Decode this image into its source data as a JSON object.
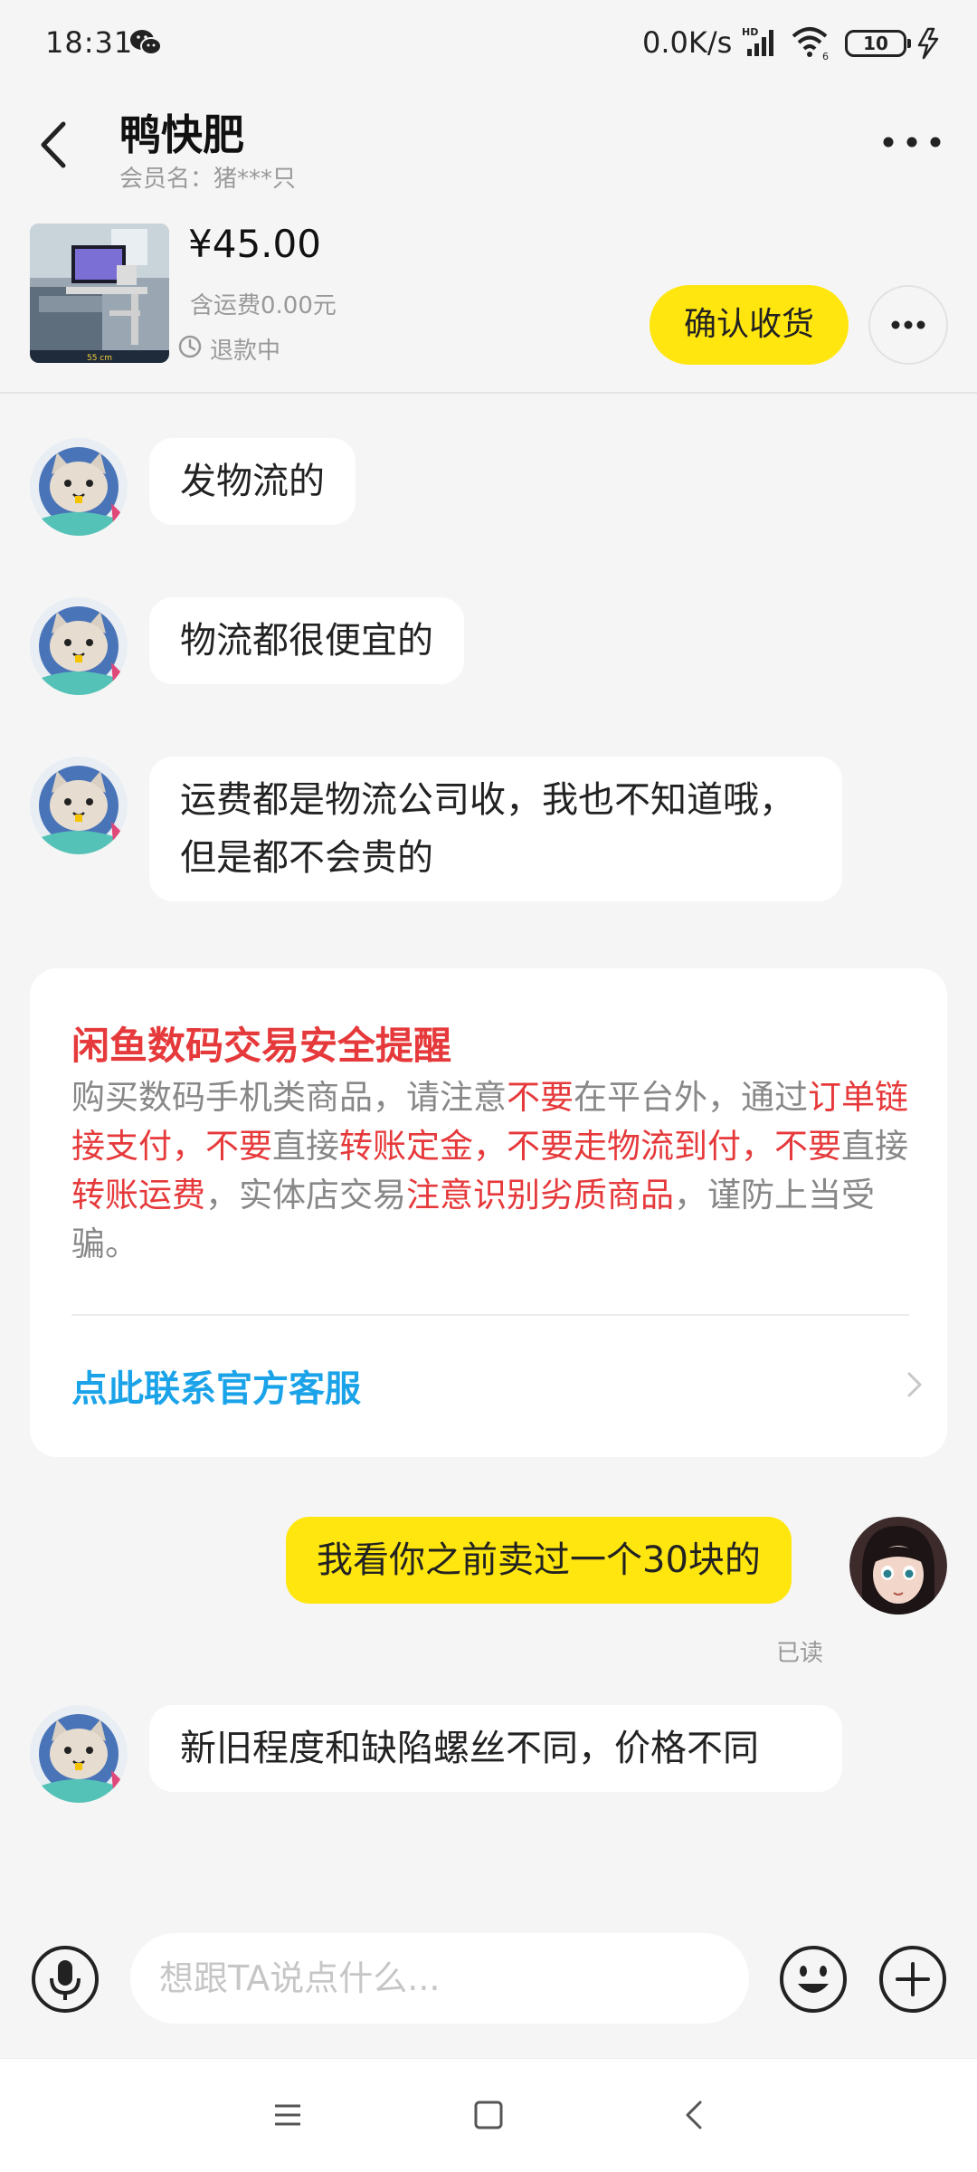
{
  "status_bar": {
    "time": "18:31",
    "network_speed": "0.0K/s",
    "battery": "10",
    "icons": [
      "wechat-icon",
      "hd-signal-icon",
      "wifi-icon",
      "battery-icon",
      "charging-icon"
    ]
  },
  "header": {
    "contact_name": "鸭快肥",
    "member_label": "会员名：猪***只",
    "product": {
      "price": "¥45.00",
      "shipping": "含运费0.00元",
      "status": "退款中",
      "confirm_button": "确认收货"
    }
  },
  "messages": [
    {
      "sender": "other",
      "text": "发物流的"
    },
    {
      "sender": "other",
      "text": "物流都很便宜的"
    },
    {
      "sender": "other",
      "text": "运费都是物流公司收，我也不知道哦，但是都不会贵的"
    },
    {
      "sender": "self",
      "text": "我看你之前卖过一个30块的",
      "read_status": "已读"
    },
    {
      "sender": "other",
      "text": "新旧程度和缺陷螺丝不同，价格不同"
    }
  ],
  "safety_notice": {
    "title": "闲鱼数码交易安全提醒",
    "segments": [
      {
        "text": "购买数码手机类商品，请注意",
        "red": false
      },
      {
        "text": "不要",
        "red": true
      },
      {
        "text": "在平台外，通过",
        "red": false
      },
      {
        "text": "订单链接支付，不要",
        "red": true
      },
      {
        "text": "直接",
        "red": false
      },
      {
        "text": "转账定金，不要走物流到付，不要",
        "red": true
      },
      {
        "text": "直接",
        "red": false
      },
      {
        "text": "转账运费",
        "red": true
      },
      {
        "text": "，实体店交易",
        "red": false
      },
      {
        "text": "注意识别劣质商品",
        "red": true
      },
      {
        "text": "，谨防上当受骗。",
        "red": false
      }
    ],
    "link_text": "点此联系官方客服"
  },
  "input": {
    "placeholder": "想跟TA说点什么..."
  },
  "colors": {
    "accent_yellow": "#ffe60f",
    "warning_red": "#e6393b",
    "link_blue": "#1aa3e8",
    "background": "#f5f5f5"
  }
}
